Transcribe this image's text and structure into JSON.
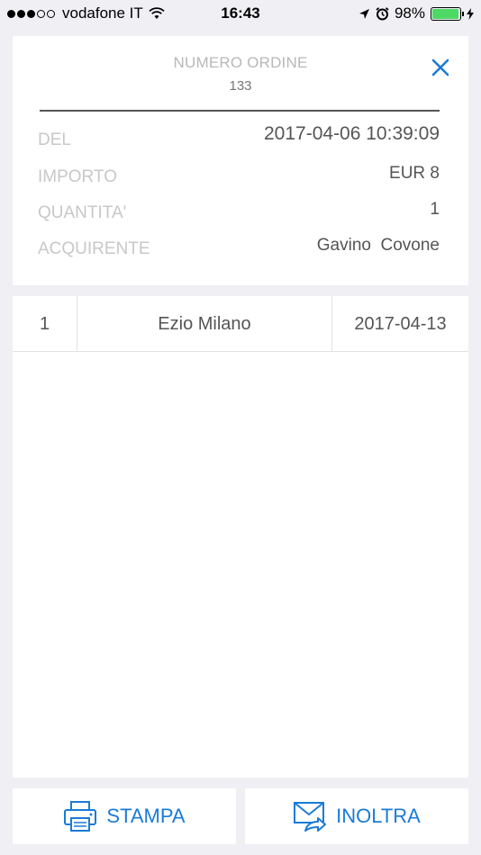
{
  "status_bar": {
    "carrier": "vodafone IT",
    "time": "16:43",
    "battery_percent": "98%",
    "battery_level": 0.98,
    "signal_bars_filled": 3,
    "signal_bars_total": 5
  },
  "order": {
    "title": "NUMERO ORDINE",
    "number": "133",
    "fields": {
      "del_label": "DEL",
      "del_value": "2017-04-06 10:39:09",
      "importo_label": "IMPORTO",
      "importo_value": "EUR 8",
      "quantita_label": "QUANTITA'",
      "quantita_value": "1",
      "acquirente_label": "ACQUIRENTE",
      "acquirente_value": "Gavino  Covone"
    }
  },
  "items": [
    {
      "num": "1",
      "name": "Ezio Milano",
      "date": "2017-04-13"
    }
  ],
  "actions": {
    "print_label": "STAMPA",
    "forward_label": "INOLTRA"
  },
  "colors": {
    "accent": "#1a7bd6",
    "background": "#efeff4",
    "battery": "#4cd964"
  },
  "icons": {
    "close": "close-icon",
    "print": "printer-icon",
    "forward": "envelope-forward-icon",
    "wifi": "wifi-icon",
    "location": "location-arrow-icon",
    "alarm": "alarm-icon",
    "charging": "charging-bolt-icon"
  }
}
